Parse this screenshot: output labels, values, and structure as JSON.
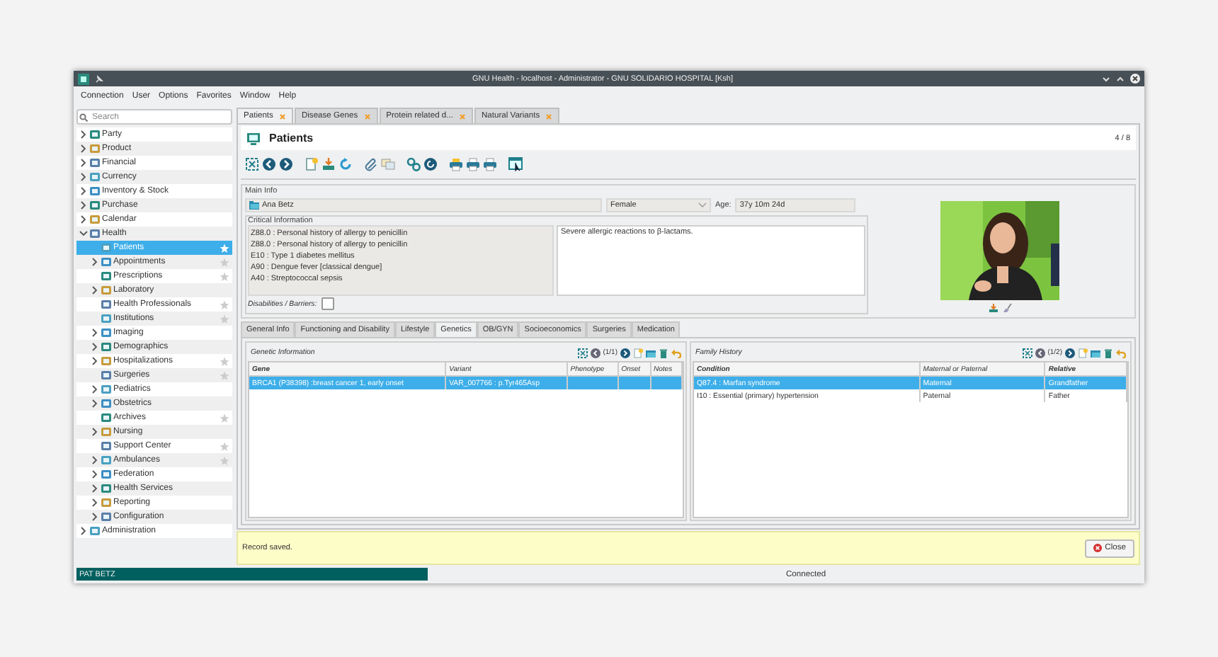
{
  "window": {
    "title": "GNU Health - localhost - Administrator - GNU SOLIDARIO HOSPITAL [Ksh]"
  },
  "menu": [
    "Connection",
    "User",
    "Options",
    "Favorites",
    "Window",
    "Help"
  ],
  "search": {
    "placeholder": "Search"
  },
  "sidebar": {
    "items": [
      {
        "label": "Party",
        "expandable": true,
        "expanded": false,
        "star": false
      },
      {
        "label": "Product",
        "expandable": true,
        "expanded": false,
        "star": false
      },
      {
        "label": "Financial",
        "expandable": true,
        "expanded": false,
        "star": false
      },
      {
        "label": "Currency",
        "expandable": true,
        "expanded": false,
        "star": false
      },
      {
        "label": "Inventory & Stock",
        "expandable": true,
        "expanded": false,
        "star": false
      },
      {
        "label": "Purchase",
        "expandable": true,
        "expanded": false,
        "star": false
      },
      {
        "label": "Calendar",
        "expandable": true,
        "expanded": false,
        "star": false
      },
      {
        "label": "Health",
        "expandable": true,
        "expanded": true,
        "star": false,
        "children": [
          {
            "label": "Patients",
            "expandable": false,
            "star": true,
            "selected": true
          },
          {
            "label": "Appointments",
            "expandable": true,
            "expanded": false,
            "star": true,
            "selected": false
          },
          {
            "label": "Prescriptions",
            "expandable": false,
            "star": true,
            "selected": false
          },
          {
            "label": "Laboratory",
            "expandable": true,
            "expanded": false,
            "star": false,
            "selected": false
          },
          {
            "label": "Health Professionals",
            "expandable": false,
            "star": true,
            "selected": false
          },
          {
            "label": "Institutions",
            "expandable": false,
            "star": true,
            "selected": false
          },
          {
            "label": "Imaging",
            "expandable": true,
            "expanded": false,
            "star": false,
            "selected": false
          },
          {
            "label": "Demographics",
            "expandable": true,
            "expanded": false,
            "star": false,
            "selected": false
          },
          {
            "label": "Hospitalizations",
            "expandable": true,
            "expanded": false,
            "star": true,
            "selected": false
          },
          {
            "label": "Surgeries",
            "expandable": false,
            "star": true,
            "selected": false
          },
          {
            "label": "Pediatrics",
            "expandable": true,
            "expanded": false,
            "star": false,
            "selected": false
          },
          {
            "label": "Obstetrics",
            "expandable": true,
            "expanded": false,
            "star": false,
            "selected": false
          },
          {
            "label": "Archives",
            "expandable": false,
            "star": true,
            "selected": false
          },
          {
            "label": "Nursing",
            "expandable": true,
            "expanded": false,
            "star": false,
            "selected": false
          },
          {
            "label": "Support Center",
            "expandable": false,
            "star": true,
            "selected": false
          },
          {
            "label": "Ambulances",
            "expandable": true,
            "expanded": false,
            "star": true,
            "selected": false
          },
          {
            "label": "Federation",
            "expandable": true,
            "expanded": false,
            "star": false,
            "selected": false
          },
          {
            "label": "Health Services",
            "expandable": true,
            "expanded": false,
            "star": false,
            "selected": false
          },
          {
            "label": "Reporting",
            "expandable": true,
            "expanded": false,
            "star": false,
            "selected": false
          },
          {
            "label": "Configuration",
            "expandable": true,
            "expanded": false,
            "star": false,
            "selected": false
          }
        ]
      },
      {
        "label": "Administration",
        "expandable": true,
        "expanded": false,
        "star": false
      }
    ]
  },
  "tabs": [
    {
      "label": "Patients",
      "selected": true
    },
    {
      "label": "Disease Genes",
      "selected": false
    },
    {
      "label": "Protein related d...",
      "selected": false
    },
    {
      "label": "Natural Variants",
      "selected": false
    }
  ],
  "form": {
    "title": "Patients",
    "record_count": "4 / 8"
  },
  "main_info": {
    "label": "Main Info",
    "patient": "Ana Betz",
    "gender": "Female",
    "age_label": "Age:",
    "age": "37y 10m 24d",
    "critical_label": "Critical Information",
    "critical_items": [
      "Z88.0 : Personal history of allergy to penicillin",
      "Z88.0 : Personal history of allergy to penicillin",
      "E10 : Type 1 diabetes mellitus",
      "A90 : Dengue fever [classical dengue]",
      "A40 : Streptococcal sepsis"
    ],
    "critical_note": "Severe allergic reactions to β-lactams.",
    "disabilities_label": "Disabilities / Barriers:",
    "disabilities_checked": false
  },
  "notebook_tabs": [
    {
      "label": "General Info",
      "selected": false
    },
    {
      "label": "Functioning and Disability",
      "selected": false
    },
    {
      "label": "Lifestyle",
      "selected": false
    },
    {
      "label": "Genetics",
      "selected": true
    },
    {
      "label": "OB/GYN",
      "selected": false
    },
    {
      "label": "Socioeconomics",
      "selected": false
    },
    {
      "label": "Surgeries",
      "selected": false
    },
    {
      "label": "Medication",
      "selected": false
    }
  ],
  "panes": [
    {
      "title": "Genetic Information",
      "pager": "(1/1)",
      "columns": [
        {
          "label": "Gene",
          "required": true
        },
        {
          "label": "Variant",
          "required": false
        },
        {
          "label": "Phenotype",
          "required": false
        },
        {
          "label": "Onset",
          "required": false
        },
        {
          "label": "Notes",
          "required": false
        }
      ],
      "rows": [
        {
          "cells": [
            "BRCA1 (P38398) :breast cancer 1, early onset",
            "VAR_007766 : p.Tyr465Asp"
          ],
          "selected": true
        }
      ]
    },
    {
      "title": "Family History",
      "pager": "(1/2)",
      "columns": [
        {
          "label": "Condition",
          "required": true
        },
        {
          "label": "Maternal or Paternal",
          "required": false
        },
        {
          "label": "Relative",
          "required": true
        }
      ],
      "rows": [
        {
          "cells": [
            "Q87.4 : Marfan syndrome",
            "Maternal",
            "Grandfather"
          ],
          "selected": true
        },
        {
          "cells": [
            "I10 : Essential (primary) hypertension",
            "Paternal",
            "Father"
          ],
          "selected": false
        }
      ]
    }
  ],
  "message": "Record saved.",
  "close_button": "Close",
  "status_bar": {
    "user": "PAT BETZ",
    "connection": "Connected"
  }
}
